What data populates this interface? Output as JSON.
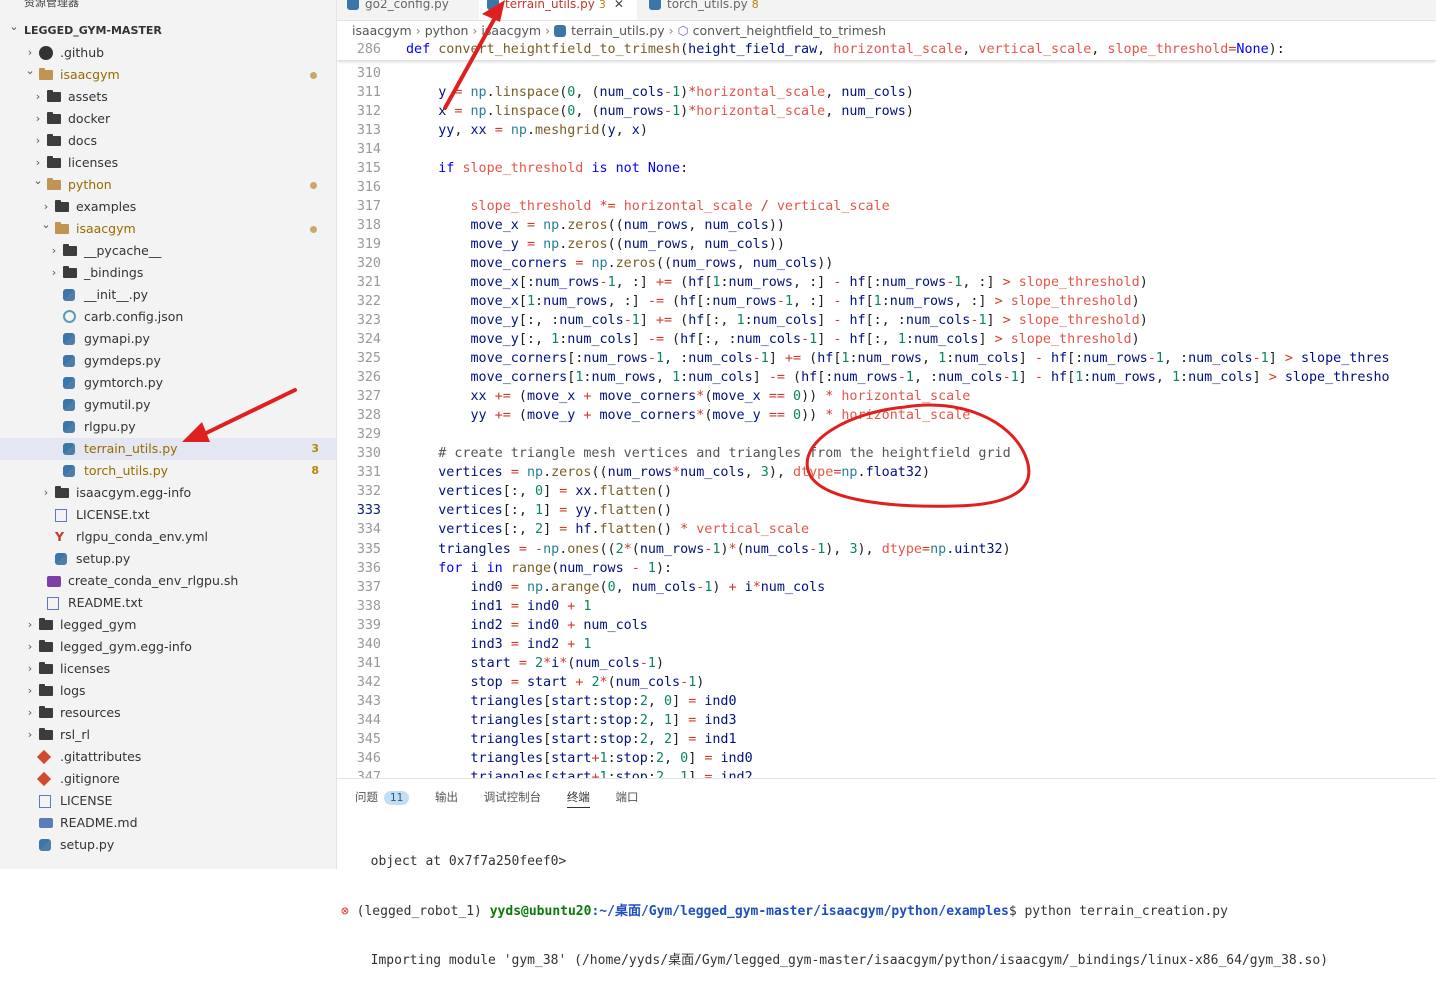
{
  "explorer": {
    "title": "资源管理器",
    "more": "···",
    "items": [
      {
        "label": "LEGGED_GYM-MASTER",
        "kind": "root",
        "depth": 0,
        "open": true
      },
      {
        "label": ".github",
        "kind": "github",
        "depth": 1,
        "open": false,
        "chev": true
      },
      {
        "label": "isaacgym",
        "kind": "folder-open",
        "depth": 1,
        "open": true,
        "chev": true,
        "dot": true
      },
      {
        "label": "assets",
        "kind": "folder",
        "depth": 2,
        "chev": true
      },
      {
        "label": "docker",
        "kind": "folder",
        "depth": 2,
        "chev": true
      },
      {
        "label": "docs",
        "kind": "folder",
        "depth": 2,
        "chev": true
      },
      {
        "label": "licenses",
        "kind": "folder",
        "depth": 2,
        "chev": true
      },
      {
        "label": "python",
        "kind": "folder-open",
        "depth": 2,
        "open": true,
        "chev": true,
        "dot": true
      },
      {
        "label": "examples",
        "kind": "folder",
        "depth": 3,
        "chev": true
      },
      {
        "label": "isaacgym",
        "kind": "folder-open",
        "depth": 3,
        "open": true,
        "chev": true,
        "dot": true
      },
      {
        "label": "__pycache__",
        "kind": "folder",
        "depth": 4,
        "chev": true
      },
      {
        "label": "_bindings",
        "kind": "folder",
        "depth": 4,
        "chev": true
      },
      {
        "label": "__init__.py",
        "kind": "py",
        "depth": 4
      },
      {
        "label": "carb.config.json",
        "kind": "json",
        "depth": 4
      },
      {
        "label": "gymapi.py",
        "kind": "py",
        "depth": 4
      },
      {
        "label": "gymdeps.py",
        "kind": "py",
        "depth": 4
      },
      {
        "label": "gymtorch.py",
        "kind": "py",
        "depth": 4
      },
      {
        "label": "gymutil.py",
        "kind": "py",
        "depth": 4
      },
      {
        "label": "rlgpu.py",
        "kind": "py",
        "depth": 4
      },
      {
        "label": "terrain_utils.py",
        "kind": "py",
        "depth": 4,
        "selected": true,
        "badge": "3",
        "warn": true
      },
      {
        "label": "torch_utils.py",
        "kind": "py",
        "depth": 4,
        "badge": "8",
        "warn": true
      },
      {
        "label": "isaacgym.egg-info",
        "kind": "folder",
        "depth": 3,
        "chev": true
      },
      {
        "label": "LICENSE.txt",
        "kind": "txt",
        "depth": 3
      },
      {
        "label": "rlgpu_conda_env.yml",
        "kind": "yml",
        "depth": 3
      },
      {
        "label": "setup.py",
        "kind": "py",
        "depth": 3
      },
      {
        "label": "create_conda_env_rlgpu.sh",
        "kind": "sh",
        "depth": 2
      },
      {
        "label": "README.txt",
        "kind": "txt",
        "depth": 2
      },
      {
        "label": "legged_gym",
        "kind": "folder",
        "depth": 1,
        "chev": true
      },
      {
        "label": "legged_gym.egg-info",
        "kind": "folder",
        "depth": 1,
        "chev": true
      },
      {
        "label": "licenses",
        "kind": "folder",
        "depth": 1,
        "chev": true
      },
      {
        "label": "logs",
        "kind": "folder",
        "depth": 1,
        "chev": true
      },
      {
        "label": "resources",
        "kind": "folder",
        "depth": 1,
        "chev": true
      },
      {
        "label": "rsl_rl",
        "kind": "folder",
        "depth": 1,
        "chev": true
      },
      {
        "label": ".gitattributes",
        "kind": "git",
        "depth": 1
      },
      {
        "label": ".gitignore",
        "kind": "git",
        "depth": 1
      },
      {
        "label": "LICENSE",
        "kind": "txt",
        "depth": 1
      },
      {
        "label": "README.md",
        "kind": "md",
        "depth": 1
      },
      {
        "label": "setup.py",
        "kind": "py",
        "depth": 1
      }
    ]
  },
  "tabs": [
    {
      "label": "go2_config.py",
      "active": false
    },
    {
      "label": "terrain_utils.py",
      "active": true,
      "count": "3",
      "close": "✕"
    },
    {
      "label": "torch_utils.py",
      "active": false,
      "count": "8"
    }
  ],
  "breadcrumb": [
    "isaacgym",
    "python",
    "isaacgym",
    "terrain_utils.py",
    "convert_heightfield_to_trimesh"
  ],
  "editor": {
    "sticky_line": "286",
    "sticky_code": "def convert_heightfield_to_trimesh(height_field_raw, horizontal_scale, vertical_scale, slope_threshold=None):",
    "current_line": "333",
    "lines": [
      {
        "n": "310",
        "t": ""
      },
      {
        "n": "311",
        "t": "    y = np.linspace(0, (num_cols-1)*horizontal_scale, num_cols)"
      },
      {
        "n": "312",
        "t": "    x = np.linspace(0, (num_rows-1)*horizontal_scale, num_rows)"
      },
      {
        "n": "313",
        "t": "    yy, xx = np.meshgrid(y, x)"
      },
      {
        "n": "314",
        "t": ""
      },
      {
        "n": "315",
        "t": "    if slope_threshold is not None:"
      },
      {
        "n": "316",
        "t": ""
      },
      {
        "n": "317",
        "t": "        slope_threshold *= horizontal_scale / vertical_scale"
      },
      {
        "n": "318",
        "t": "        move_x = np.zeros((num_rows, num_cols))"
      },
      {
        "n": "319",
        "t": "        move_y = np.zeros((num_rows, num_cols))"
      },
      {
        "n": "320",
        "t": "        move_corners = np.zeros((num_rows, num_cols))"
      },
      {
        "n": "321",
        "t": "        move_x[:num_rows-1, :] += (hf[1:num_rows, :] - hf[:num_rows-1, :] > slope_threshold)"
      },
      {
        "n": "322",
        "t": "        move_x[1:num_rows, :] -= (hf[:num_rows-1, :] - hf[1:num_rows, :] > slope_threshold)"
      },
      {
        "n": "323",
        "t": "        move_y[:, :num_cols-1] += (hf[:, 1:num_cols] - hf[:, :num_cols-1] > slope_threshold)"
      },
      {
        "n": "324",
        "t": "        move_y[:, 1:num_cols] -= (hf[:, :num_cols-1] - hf[:, 1:num_cols] > slope_threshold)"
      },
      {
        "n": "325",
        "t": "        move_corners[:num_rows-1, :num_cols-1] += (hf[1:num_rows, 1:num_cols] - hf[:num_rows-1, :num_cols-1] > slope_thres"
      },
      {
        "n": "326",
        "t": "        move_corners[1:num_rows, 1:num_cols] -= (hf[:num_rows-1, :num_cols-1] - hf[1:num_rows, 1:num_cols] > slope_thresho"
      },
      {
        "n": "327",
        "t": "        xx += (move_x + move_corners*(move_x == 0)) * horizontal_scale"
      },
      {
        "n": "328",
        "t": "        yy += (move_y + move_corners*(move_y == 0)) * horizontal_scale"
      },
      {
        "n": "329",
        "t": ""
      },
      {
        "n": "330",
        "t": "    # create triangle mesh vertices and triangles from the heightfield grid"
      },
      {
        "n": "331",
        "t": "    vertices = np.zeros((num_rows*num_cols, 3), dtype=np.float32)"
      },
      {
        "n": "332",
        "t": "    vertices[:, 0] = xx.flatten()"
      },
      {
        "n": "333",
        "t": "    vertices[:, 1] = yy.flatten()"
      },
      {
        "n": "334",
        "t": "    vertices[:, 2] = hf.flatten() * vertical_scale"
      },
      {
        "n": "335",
        "t": "    triangles = -np.ones((2*(num_rows-1)*(num_cols-1), 3), dtype=np.uint32)"
      },
      {
        "n": "336",
        "t": "    for i in range(num_rows - 1):"
      },
      {
        "n": "337",
        "t": "        ind0 = np.arange(0, num_cols-1) + i*num_cols"
      },
      {
        "n": "338",
        "t": "        ind1 = ind0 + 1"
      },
      {
        "n": "339",
        "t": "        ind2 = ind0 + num_cols"
      },
      {
        "n": "340",
        "t": "        ind3 = ind2 + 1"
      },
      {
        "n": "341",
        "t": "        start = 2*i*(num_cols-1)"
      },
      {
        "n": "342",
        "t": "        stop = start + 2*(num_cols-1)"
      },
      {
        "n": "343",
        "t": "        triangles[start:stop:2, 0] = ind0"
      },
      {
        "n": "344",
        "t": "        triangles[start:stop:2, 1] = ind3"
      },
      {
        "n": "345",
        "t": "        triangles[start:stop:2, 2] = ind1"
      },
      {
        "n": "346",
        "t": "        triangles[start+1:stop:2, 0] = ind0"
      },
      {
        "n": "347",
        "t": "        triangles[start+1:stop:2, 1] = ind2"
      }
    ]
  },
  "panel": {
    "tabs": [
      "问题",
      "11",
      "输出",
      "调试控制台",
      "终端",
      "端口"
    ],
    "terminal": {
      "line1": "  object at 0x7f7a250feef0>",
      "mark": "⊗",
      "env": " (legged_robot_1) ",
      "user": "yyds@ubuntu20",
      "path": ":~/桌面/Gym/legged_gym-master/isaacgym/python/examples",
      "cmd": "$ python terrain_creation.py",
      "line3": "  Importing module 'gym_38' (/home/yyds/桌面/Gym/legged_gym-master/isaacgym/python/isaacgym/_bindings/linux-x86_64/gym_38.so)"
    }
  },
  "colors": {
    "accent": "#e02020",
    "selected": "#e4e6f1",
    "warn": "#b8860b"
  }
}
